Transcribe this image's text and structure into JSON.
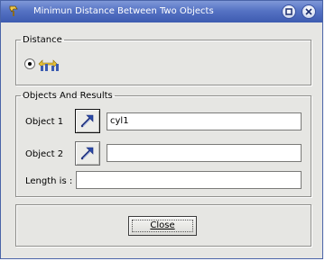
{
  "window": {
    "title": "Minimun Distance Between Two Objects",
    "app_icon": "tool-icon",
    "controls": [
      "maximize-icon",
      "close-icon"
    ]
  },
  "distance": {
    "legend": "Distance",
    "mode_selected": true,
    "mode_icon": "min-distance-icon"
  },
  "objects": {
    "legend": "Objects And Results",
    "object1": {
      "label": "Object 1",
      "value": "cyl1",
      "pick_icon": "select-arrow-icon"
    },
    "object2": {
      "label": "Object 2",
      "value": "",
      "pick_icon": "select-arrow-icon"
    },
    "length": {
      "label": "Length is :",
      "value": ""
    }
  },
  "actions": {
    "close_label": "Close"
  },
  "colors": {
    "titlebar": "#5673c4",
    "dialog_bg": "#e6e6e3"
  }
}
